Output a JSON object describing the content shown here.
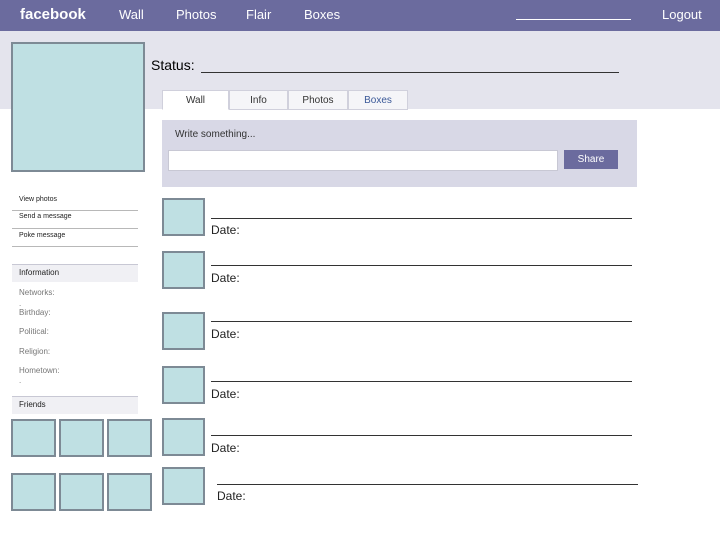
{
  "topbar": {
    "brand": "facebook",
    "nav": [
      "Wall",
      "Photos",
      "Flair",
      "Boxes"
    ],
    "logout": "Logout"
  },
  "status": {
    "label": "Status:"
  },
  "tabs": [
    "Wall",
    "Info",
    "Photos",
    "Boxes"
  ],
  "publisher": {
    "placeholder": "Write something...",
    "share_label": "Share"
  },
  "sidebar": {
    "links": [
      "View photos",
      "Send a message",
      "Poke message"
    ],
    "information_heading": "Information",
    "info_labels": [
      "Networks:",
      "Birthday:",
      "Political:",
      "Religion:",
      "Hometown:"
    ],
    "friends_heading": "Friends"
  },
  "feed": {
    "date_label": "Date:"
  },
  "colors": {
    "topbar": "#6b6b9e",
    "band": "#e4e4ed",
    "thumb_fill": "#bfe0e3",
    "thumb_border": "#7d8a95",
    "tab_link": "#3b5998"
  }
}
